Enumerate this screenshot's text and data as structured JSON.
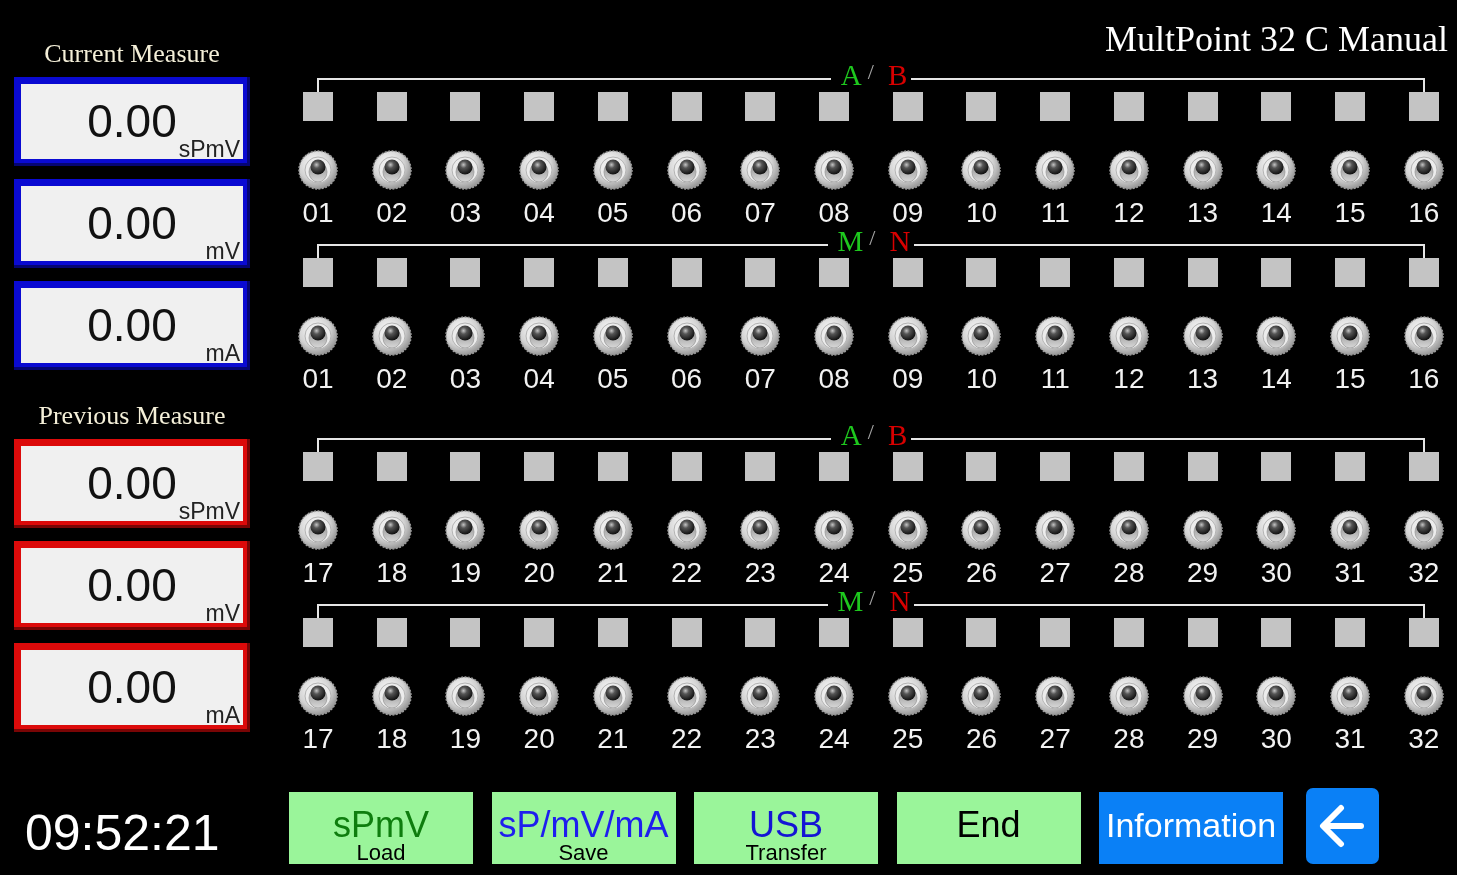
{
  "title": "MultPoint 32 C Manual",
  "measure_panels": [
    {
      "heading": "Current Measure",
      "color": "#0a0ad2",
      "readings": [
        {
          "value": "0.00",
          "unit": "sPmV"
        },
        {
          "value": "0.00",
          "unit": "mV"
        },
        {
          "value": "0.00",
          "unit": "mA"
        }
      ]
    },
    {
      "heading": "Previous Measure",
      "color": "#dc0a0a",
      "readings": [
        {
          "value": "0.00",
          "unit": "sPmV"
        },
        {
          "value": "0.00",
          "unit": "mV"
        },
        {
          "value": "0.00",
          "unit": "mA"
        }
      ]
    }
  ],
  "clock": "09:52:21",
  "switch_banks": [
    {
      "groups": [
        {
          "labels": [
            {
              "text": "A",
              "color": "#1ec81e"
            },
            {
              "text": "B",
              "color": "#d80000"
            }
          ],
          "separator": "/",
          "channels": [
            "01",
            "02",
            "03",
            "04",
            "05",
            "06",
            "07",
            "08",
            "09",
            "10",
            "11",
            "12",
            "13",
            "14",
            "15",
            "16"
          ]
        },
        {
          "labels": [
            {
              "text": "M",
              "color": "#1ec81e"
            },
            {
              "text": "N",
              "color": "#d80000"
            }
          ],
          "separator": "/",
          "channels": [
            "01",
            "02",
            "03",
            "04",
            "05",
            "06",
            "07",
            "08",
            "09",
            "10",
            "11",
            "12",
            "13",
            "14",
            "15",
            "16"
          ]
        }
      ]
    },
    {
      "groups": [
        {
          "labels": [
            {
              "text": "A",
              "color": "#1ec81e"
            },
            {
              "text": "B",
              "color": "#d80000"
            }
          ],
          "separator": "/",
          "channels": [
            "17",
            "18",
            "19",
            "20",
            "21",
            "22",
            "23",
            "24",
            "25",
            "26",
            "27",
            "28",
            "29",
            "30",
            "31",
            "32"
          ]
        },
        {
          "labels": [
            {
              "text": "M",
              "color": "#1ec81e"
            },
            {
              "text": "N",
              "color": "#d80000"
            }
          ],
          "separator": "/",
          "channels": [
            "17",
            "18",
            "19",
            "20",
            "21",
            "22",
            "23",
            "24",
            "25",
            "26",
            "27",
            "28",
            "29",
            "30",
            "31",
            "32"
          ]
        }
      ]
    }
  ],
  "buttons": [
    {
      "kind": "load",
      "label": "sPmV",
      "sublabel": "Load"
    },
    {
      "kind": "save",
      "label": "sP/mV/mA",
      "sublabel": "Save"
    },
    {
      "kind": "transfer",
      "label": "USB",
      "sublabel": "Transfer"
    },
    {
      "kind": "end",
      "label": "End"
    },
    {
      "kind": "info",
      "label": "Information"
    },
    {
      "kind": "back"
    }
  ]
}
